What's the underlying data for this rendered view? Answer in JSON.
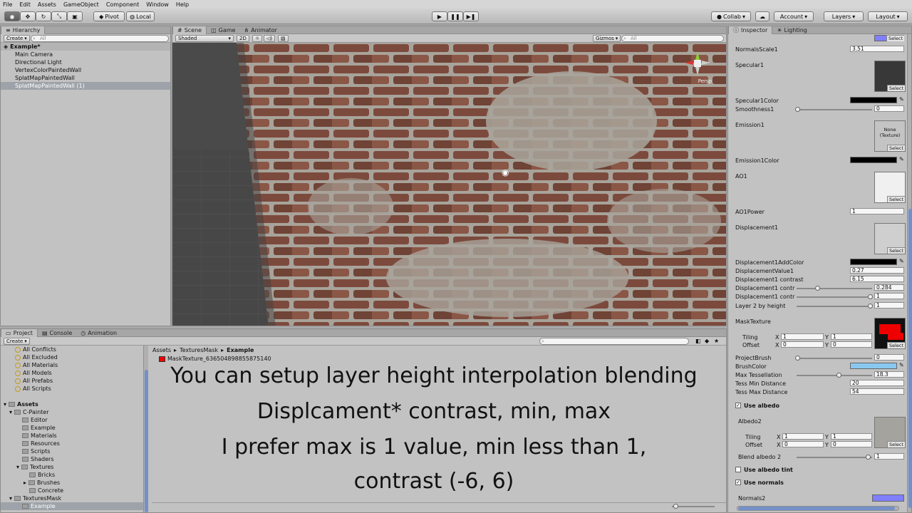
{
  "menu": [
    "File",
    "Edit",
    "Assets",
    "GameObject",
    "Component",
    "Window",
    "Help"
  ],
  "toolbar": {
    "pivot": "Pivot",
    "local": "Local",
    "collab": "Collab",
    "account": "Account",
    "layers": "Layers",
    "layout": "Layout"
  },
  "hierarchy": {
    "tab": "Hierarchy",
    "create": "Create",
    "search_placeholder": "All",
    "scene": "Example*",
    "items": [
      "Main Camera",
      "Directional Light",
      "VertexColorPaintedWall",
      "SplatMapPaintedWall",
      "SplatMapPaintedWall (1)"
    ]
  },
  "scene": {
    "tabs": [
      "Scene",
      "Game",
      "Animator"
    ],
    "shaded": "Shaded",
    "mode2d": "2D",
    "gizmos": "Gizmos",
    "search_placeholder": "All",
    "persp": "Persp"
  },
  "project": {
    "tabs": [
      "Project",
      "Console",
      "Animation"
    ],
    "create": "Create",
    "favorites": [
      "All Conflicts",
      "All Excluded",
      "All Materials",
      "All Models",
      "All Prefabs",
      "All Scripts"
    ],
    "assets_label": "Assets",
    "cpainter": "C-Painter",
    "cpainter_children": [
      "Editor",
      "Example",
      "Materials",
      "Resources",
      "Scripts",
      "Shaders"
    ],
    "textures": "Textures",
    "texture_children": [
      "Bricks",
      "Brushes",
      "Concrete"
    ],
    "texturesmask": "TexturesMask",
    "example": "Example",
    "breadcrumb": [
      "Assets",
      "TexturesMask",
      "Example"
    ],
    "file": "MaskTexture_636504898855875140"
  },
  "caption": [
    "You can setup layer height interpolation blending",
    "Displcament* contrast, min, max",
    "I prefer max is 1 value, min less than 1,",
    "contrast (-6, 6)"
  ],
  "inspector": {
    "tabs": [
      "Inspector",
      "Lighting"
    ],
    "select": "Select",
    "normals_scale_label": "NormalsScale1",
    "normals_scale_value": "3.51",
    "specular": "Specular1",
    "specular_color": "Specular1Color",
    "smoothness_label": "Smoothness1",
    "smoothness_value": "0",
    "emission": "Emission1",
    "emission_none": "None (Texture)",
    "emission_color": "Emission1Color",
    "ao": "AO1",
    "ao_power_label": "AO1Power",
    "ao_power_value": "1",
    "displacement": "Displacement1",
    "disp_add_color": "Displacement1AddColor",
    "disp_value_label": "DisplacementValue1",
    "disp_value": "0.27",
    "disp_contrast_label": "Displacement1 contrast",
    "disp_contrast": "6.15",
    "disp_min_label": "Displacement1 contr",
    "disp_min": "0.284",
    "disp_max_label": "Displacement1 contr",
    "disp_max": "1",
    "layer2_label": "Layer 2 by height",
    "layer2_value": "1",
    "mask_texture": "MaskTexture",
    "tiling": "Tiling",
    "offset": "Offset",
    "x": "X",
    "y": "Y",
    "one": "1",
    "zero": "0",
    "project_brush_label": "ProjectBrush",
    "project_brush_value": "0",
    "brush_color": "BrushColor",
    "max_tess_label": "Max Tessellation",
    "max_tess_value": "18.3",
    "tess_min_label": "Tess Min Distance",
    "tess_min_value": "20",
    "tess_max_label": "Tess Max Distance",
    "tess_max_value": "54",
    "use_albedo": "Use albedo",
    "albedo2": "Albedo2",
    "blend_albedo_label": "Blend albedo 2",
    "blend_albedo_value": "1",
    "use_albedo_tint": "Use albedo tint",
    "use_normals": "Use normals",
    "normals2": "Normals2"
  },
  "colors": {
    "accent": "#7590c8",
    "brush": "#88c8f0",
    "normal_map": "#8080ff"
  }
}
